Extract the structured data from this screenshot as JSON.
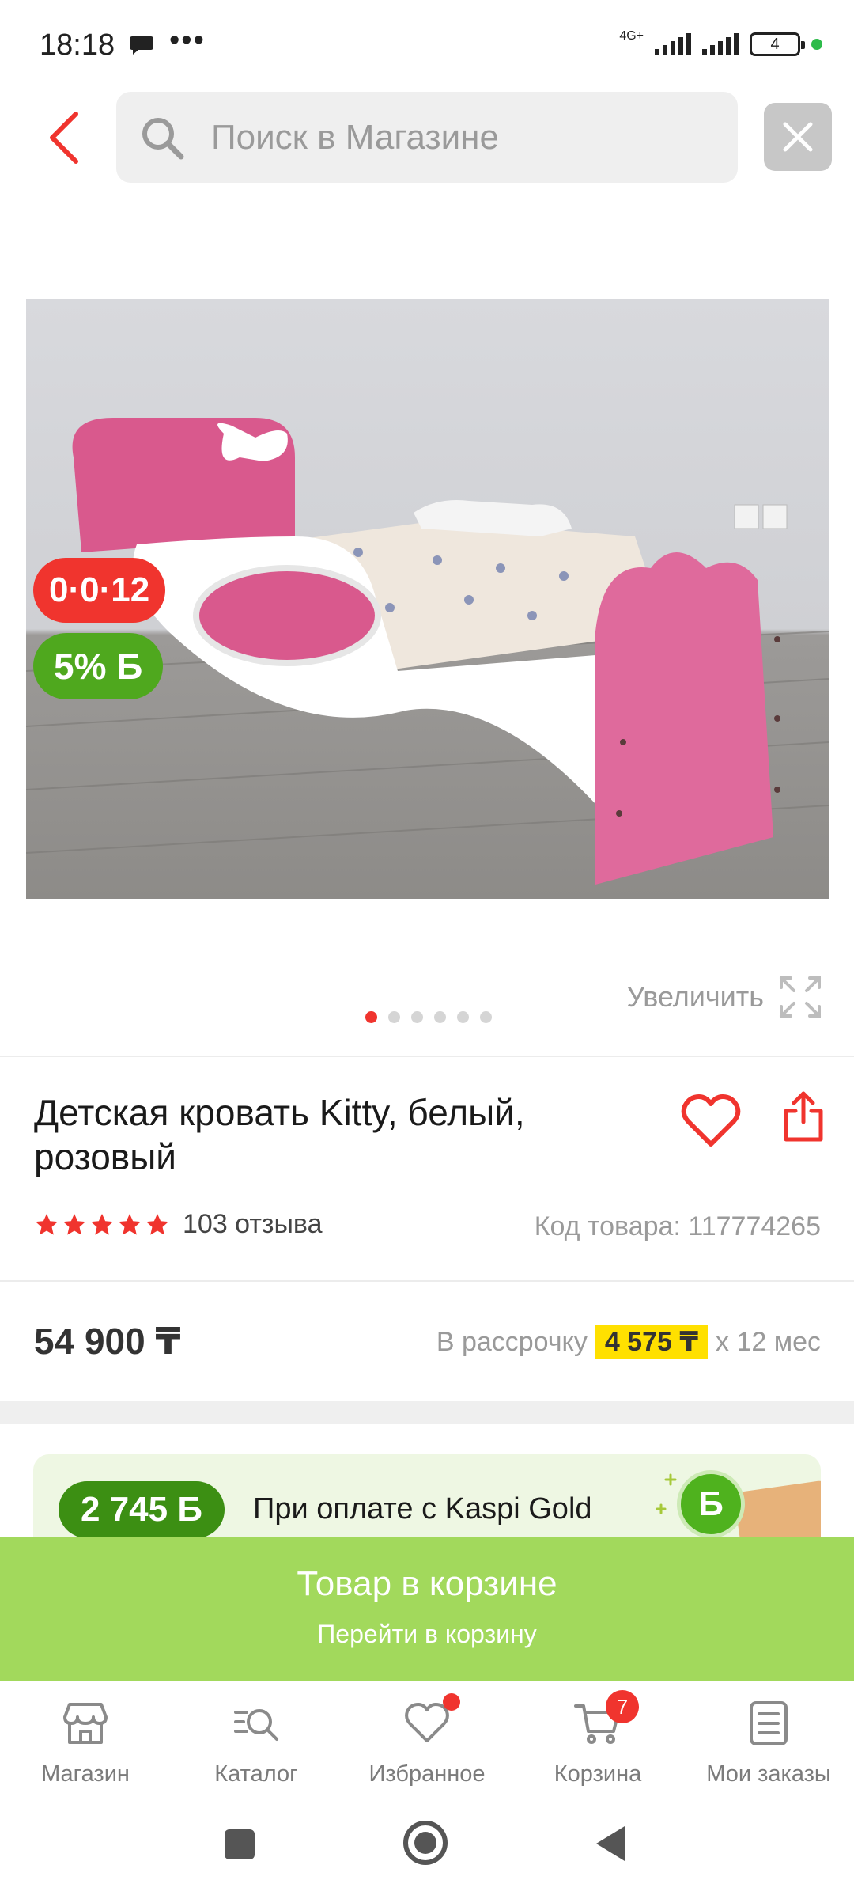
{
  "status_bar": {
    "time": "18:18",
    "dots": "•••",
    "network": "4G+",
    "battery": "4"
  },
  "header": {
    "search_placeholder": "Поиск в Магазине"
  },
  "gallery": {
    "badge_timer": "0·0·12",
    "badge_bonus": "5% Б",
    "zoom_label": "Увеличить",
    "current_slide": 1,
    "total_slides": 6
  },
  "product": {
    "title": "Детская кровать Kitty, белый, розовый",
    "rating": 5,
    "reviews": "103 отзыва",
    "code": "Код товара: 117774265",
    "price": "54 900 ₸",
    "installment_prefix": "В рассрочку",
    "installment_amount": "4 575 ₸",
    "installment_suffix": "x 12 мес"
  },
  "kaspi": {
    "bonus": "2 745 Б",
    "text": "При оплате с Kaspi Gold",
    "coin": "Б"
  },
  "cart_banner": {
    "title": "Товар в корзине",
    "subtitle": "Перейти в корзину"
  },
  "bottom_nav": [
    {
      "label": "Магазин",
      "icon": "store-icon"
    },
    {
      "label": "Каталог",
      "icon": "catalog-icon"
    },
    {
      "label": "Избранное",
      "icon": "heart-icon"
    },
    {
      "label": "Корзина",
      "icon": "cart-icon",
      "count": "7"
    },
    {
      "label": "Мои заказы",
      "icon": "orders-icon"
    }
  ],
  "colors": {
    "accent_red": "#f0342e",
    "bonus_green": "#4fa81e",
    "banner_green": "#a2d95c",
    "highlight_yellow": "#ffe000"
  }
}
